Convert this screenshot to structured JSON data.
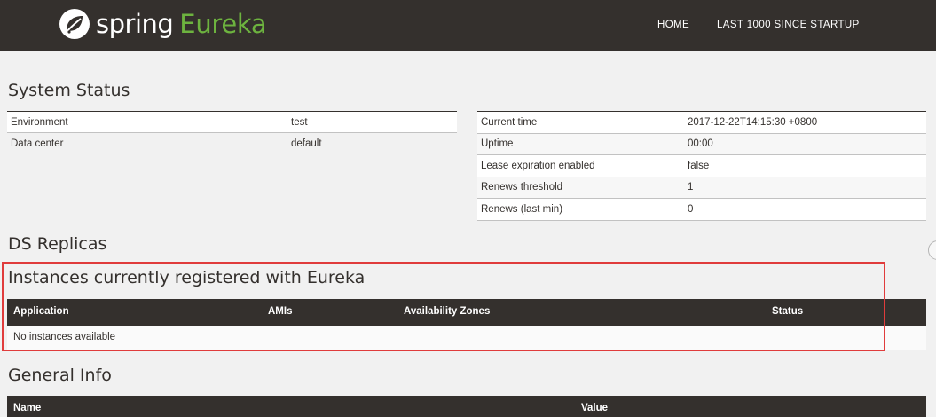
{
  "navbar": {
    "brand_spring": "spring",
    "brand_eureka": "Eureka",
    "links": [
      "HOME",
      "LAST 1000 SINCE STARTUP"
    ],
    "brand_icon": "spring-leaf-icon",
    "colors": {
      "background": "#34302d",
      "accent": "#6db33f"
    }
  },
  "system_status": {
    "title": "System Status",
    "left": [
      {
        "key": "Environment",
        "value": "test"
      },
      {
        "key": "Data center",
        "value": "default"
      }
    ],
    "right": [
      {
        "key": "Current time",
        "value": "2017-12-22T14:15:30 +0800"
      },
      {
        "key": "Uptime",
        "value": "00:00"
      },
      {
        "key": "Lease expiration enabled",
        "value": "false"
      },
      {
        "key": "Renews threshold",
        "value": "1"
      },
      {
        "key": "Renews (last min)",
        "value": "0"
      }
    ]
  },
  "ds_replicas": {
    "title": "DS Replicas"
  },
  "instances": {
    "title": "Instances currently registered with Eureka",
    "columns": [
      "Application",
      "AMIs",
      "Availability Zones",
      "Status"
    ],
    "empty_message": "No instances available",
    "highlight_color": "#e03c3c"
  },
  "general_info": {
    "title": "General Info",
    "columns": [
      "Name",
      "Value"
    ]
  }
}
